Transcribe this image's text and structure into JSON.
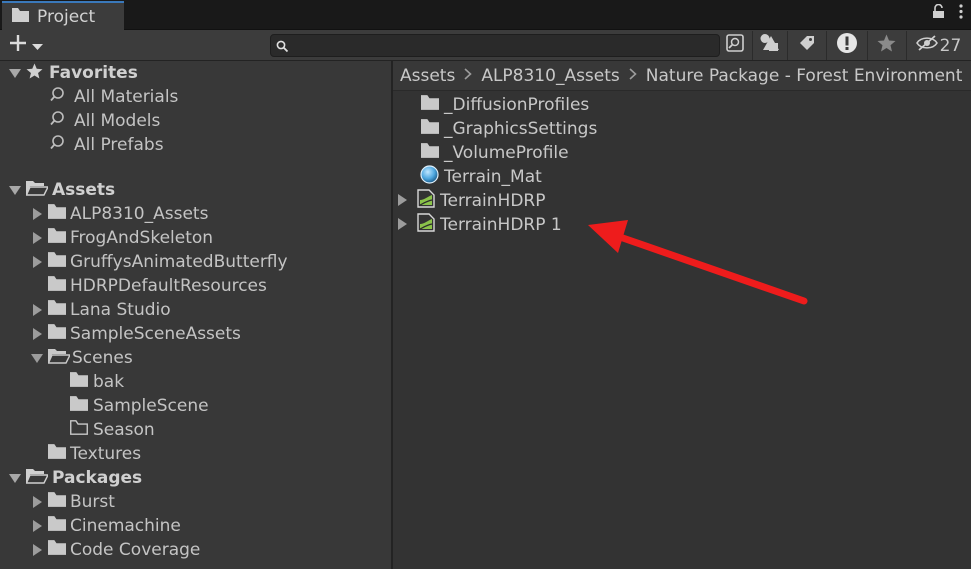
{
  "window": {
    "tab_label": "Project",
    "hidden_count": "27"
  },
  "search": {
    "placeholder": "",
    "value": ""
  },
  "sidebar": {
    "favorites": {
      "label": "Favorites",
      "items": [
        "All Materials",
        "All Models",
        "All Prefabs"
      ]
    },
    "assets": {
      "label": "Assets",
      "items": [
        {
          "label": "ALP8310_Assets",
          "has_children": true
        },
        {
          "label": "FrogAndSkeleton",
          "has_children": true
        },
        {
          "label": "GruffysAnimatedButterfly",
          "has_children": true
        },
        {
          "label": "HDRPDefaultResources",
          "has_children": false
        },
        {
          "label": "Lana Studio",
          "has_children": true
        },
        {
          "label": "SampleSceneAssets",
          "has_children": true
        }
      ],
      "scenes": {
        "label": "Scenes",
        "children": [
          {
            "label": "bak",
            "empty": false
          },
          {
            "label": "SampleScene",
            "empty": false
          },
          {
            "label": "Season",
            "empty": true
          }
        ]
      },
      "textures": "Textures"
    },
    "packages": {
      "label": "Packages",
      "items": [
        "Burst",
        "Cinemachine",
        "Code Coverage"
      ]
    }
  },
  "breadcrumb": [
    "Assets",
    "ALP8310_Assets",
    "Nature Package - Forest Environment"
  ],
  "files": [
    {
      "label": "_DiffusionProfiles",
      "type": "folder"
    },
    {
      "label": "_GraphicsSettings",
      "type": "folder"
    },
    {
      "label": "_VolumeProfile",
      "type": "folder"
    },
    {
      "label": "Terrain_Mat",
      "type": "material"
    },
    {
      "label": "TerrainHDRP",
      "type": "terrain"
    },
    {
      "label": "TerrainHDRP 1",
      "type": "terrain"
    }
  ],
  "colors": {
    "annotation_arrow": "#ee1c1c",
    "terrain_icon": "#8bc34a",
    "material_icon": "#4fa8e0"
  }
}
